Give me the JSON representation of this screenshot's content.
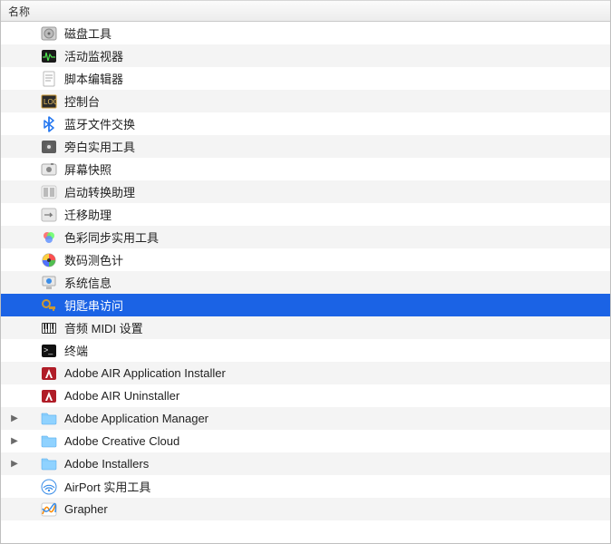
{
  "header": {
    "name_column": "名称"
  },
  "selection_color": "#1b63e5",
  "rows": [
    {
      "icon": "disk-utility-icon",
      "label": "磁盘工具",
      "folder": false,
      "selected": false
    },
    {
      "icon": "activity-monitor-icon",
      "label": "活动监视器",
      "folder": false,
      "selected": false
    },
    {
      "icon": "script-editor-icon",
      "label": "脚本编辑器",
      "folder": false,
      "selected": false
    },
    {
      "icon": "console-icon",
      "label": "控制台",
      "folder": false,
      "selected": false
    },
    {
      "icon": "bluetooth-exchange-icon",
      "label": "蓝牙文件交换",
      "folder": false,
      "selected": false
    },
    {
      "icon": "voiceover-utility-icon",
      "label": "旁白实用工具",
      "folder": false,
      "selected": false
    },
    {
      "icon": "screenshot-icon",
      "label": "屏幕快照",
      "folder": false,
      "selected": false
    },
    {
      "icon": "bootcamp-icon",
      "label": "启动转换助理",
      "folder": false,
      "selected": false
    },
    {
      "icon": "migration-icon",
      "label": "迁移助理",
      "folder": false,
      "selected": false
    },
    {
      "icon": "colorsync-icon",
      "label": "色彩同步实用工具",
      "folder": false,
      "selected": false
    },
    {
      "icon": "colormeter-icon",
      "label": "数码测色计",
      "folder": false,
      "selected": false
    },
    {
      "icon": "systeminfo-icon",
      "label": "系统信息",
      "folder": false,
      "selected": false
    },
    {
      "icon": "keychain-icon",
      "label": "钥匙串访问",
      "folder": false,
      "selected": true
    },
    {
      "icon": "audio-midi-icon",
      "label": "音频 MIDI 设置",
      "folder": false,
      "selected": false
    },
    {
      "icon": "terminal-icon",
      "label": "终端",
      "folder": false,
      "selected": false
    },
    {
      "icon": "adobe-air-installer-icon",
      "label": "Adobe AIR Application Installer",
      "folder": false,
      "selected": false
    },
    {
      "icon": "adobe-air-uninstaller-icon",
      "label": "Adobe AIR Uninstaller",
      "folder": false,
      "selected": false
    },
    {
      "icon": "folder-icon",
      "label": "Adobe Application Manager",
      "folder": true,
      "selected": false
    },
    {
      "icon": "folder-icon",
      "label": "Adobe Creative Cloud",
      "folder": true,
      "selected": false
    },
    {
      "icon": "folder-icon",
      "label": "Adobe Installers",
      "folder": true,
      "selected": false
    },
    {
      "icon": "airport-utility-icon",
      "label": "AirPort 实用工具",
      "folder": false,
      "selected": false
    },
    {
      "icon": "grapher-icon",
      "label": "Grapher",
      "folder": false,
      "selected": false
    }
  ]
}
